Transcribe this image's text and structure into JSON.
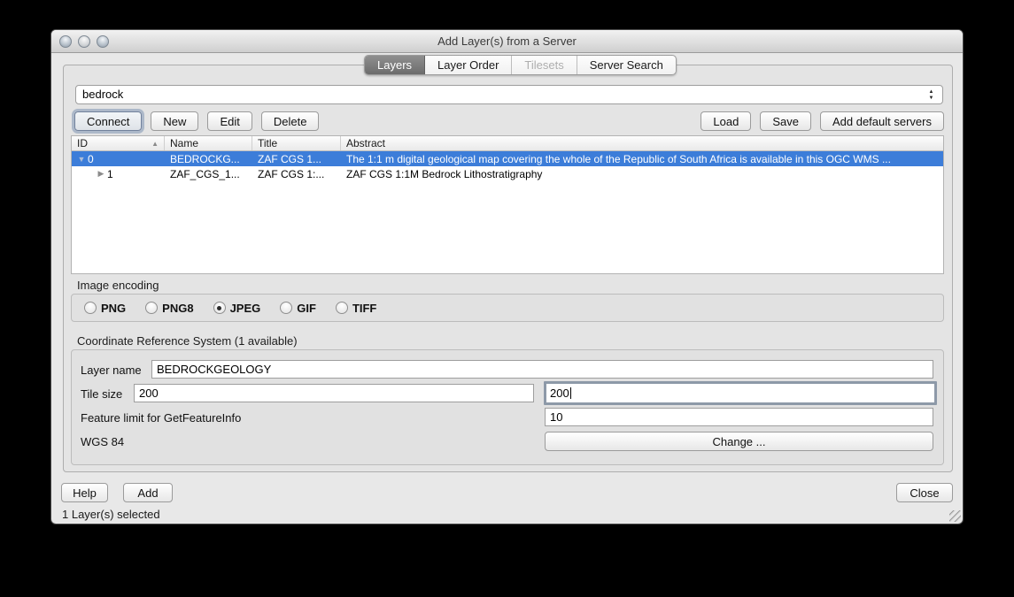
{
  "window": {
    "title": "Add Layer(s) from a Server",
    "status_text": "1 Layer(s) selected"
  },
  "tabs": [
    {
      "label": "Layers",
      "state": "selected"
    },
    {
      "label": "Layer Order",
      "state": "normal"
    },
    {
      "label": "Tilesets",
      "state": "disabled"
    },
    {
      "label": "Server Search",
      "state": "normal"
    }
  ],
  "connection": {
    "server_value": "bedrock",
    "connect_label": "Connect",
    "new_label": "New",
    "edit_label": "Edit",
    "delete_label": "Delete",
    "load_label": "Load",
    "save_label": "Save",
    "add_default_label": "Add default servers"
  },
  "layer_table": {
    "columns": {
      "id": "ID",
      "name": "Name",
      "title": "Title",
      "abstract": "Abstract"
    },
    "rows": [
      {
        "id": "0",
        "name": "BEDROCKG...",
        "title": "ZAF CGS 1...",
        "abstract": "The 1:1 m digital geological map covering the whole of the Republic of South Africa is available in this OGC WMS ...",
        "selected": true,
        "expanded": true
      },
      {
        "id": "1",
        "name": "ZAF_CGS_1...",
        "title": "ZAF CGS 1:...",
        "abstract": "ZAF CGS 1:1M Bedrock Lithostratigraphy",
        "selected": false,
        "expanded": false
      }
    ]
  },
  "image_encoding": {
    "label": "Image encoding",
    "options": {
      "png": "PNG",
      "png8": "PNG8",
      "jpeg": "JPEG",
      "gif": "GIF",
      "tiff": "TIFF"
    },
    "selected": "JPEG"
  },
  "crs_section": {
    "label": "Coordinate Reference System (1 available)",
    "layer_name_label": "Layer name",
    "layer_name_value": "BEDROCKGEOLOGY",
    "tile_size_label": "Tile size",
    "tile_width_value": "200",
    "tile_height_value": "200",
    "feature_limit_label": "Feature limit for GetFeatureInfo",
    "feature_limit_value": "10",
    "crs_value": "WGS 84",
    "change_label": "Change ..."
  },
  "footer": {
    "help_label": "Help",
    "add_label": "Add",
    "close_label": "Close"
  },
  "colors": {
    "selection_blue": "#3c7dd9",
    "window_gray": "#e8e8e8",
    "tab_selected_gray": "#6c6c6c"
  }
}
